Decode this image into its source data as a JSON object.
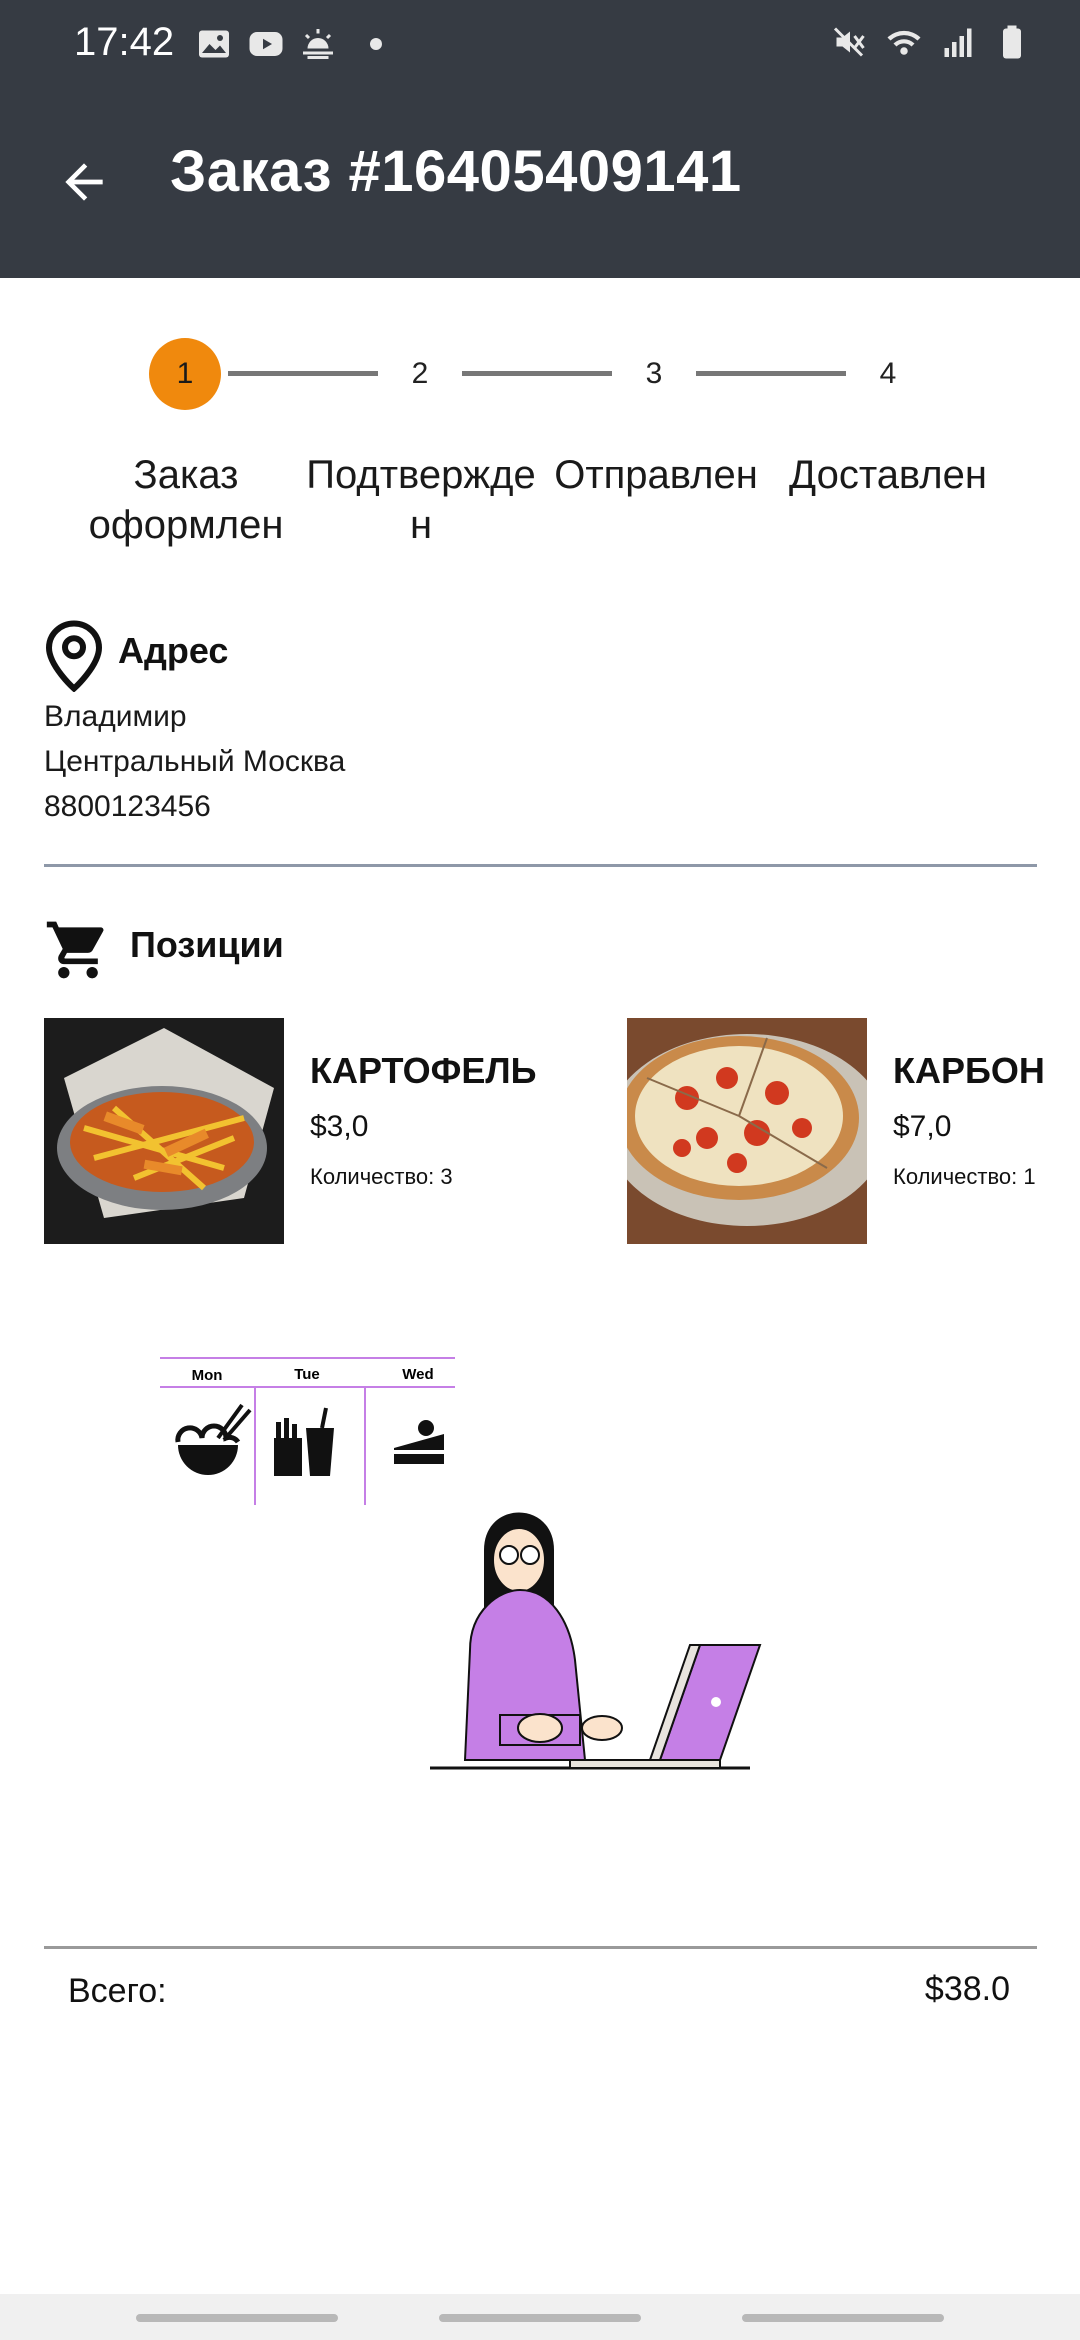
{
  "status_bar": {
    "time": "17:42",
    "left_icons": [
      "image-icon",
      "youtube-icon",
      "weather-icon",
      "dot-icon"
    ],
    "right_icons": [
      "mute-icon",
      "wifi-icon",
      "signal-icon",
      "battery-icon"
    ]
  },
  "app_bar": {
    "back_icon": "arrow-left-icon",
    "title": "Заказ #16405409141"
  },
  "stepper": {
    "active_step": 1,
    "accent_color": "#f0890d",
    "steps": [
      {
        "number": "1",
        "label": "Заказ оформлен"
      },
      {
        "number": "2",
        "label": "Подтвержден"
      },
      {
        "number": "3",
        "label": "Отправлен"
      },
      {
        "number": "4",
        "label": "Доставлен"
      }
    ]
  },
  "address": {
    "icon": "location-pin-icon",
    "title": "Адрес",
    "name": "Владимир",
    "location": "Центральный Москва",
    "phone": "8800123456"
  },
  "items_section": {
    "icon": "cart-icon",
    "title": "Позиции",
    "qty_label": "Количество:",
    "items": [
      {
        "name": "КАРТОФЕЛЬ",
        "price": "$3,0",
        "quantity": "3"
      },
      {
        "name": "КАРБОН",
        "price": "$7,0",
        "quantity": "1"
      }
    ]
  },
  "illustration": {
    "days": [
      "Mon",
      "Tue",
      "Wed"
    ]
  },
  "total": {
    "label": "Всего:",
    "value": "$38.0"
  },
  "colors": {
    "header_bg": "#363b43",
    "accent": "#f0890d",
    "illustration_purple": "#c57fe6"
  }
}
